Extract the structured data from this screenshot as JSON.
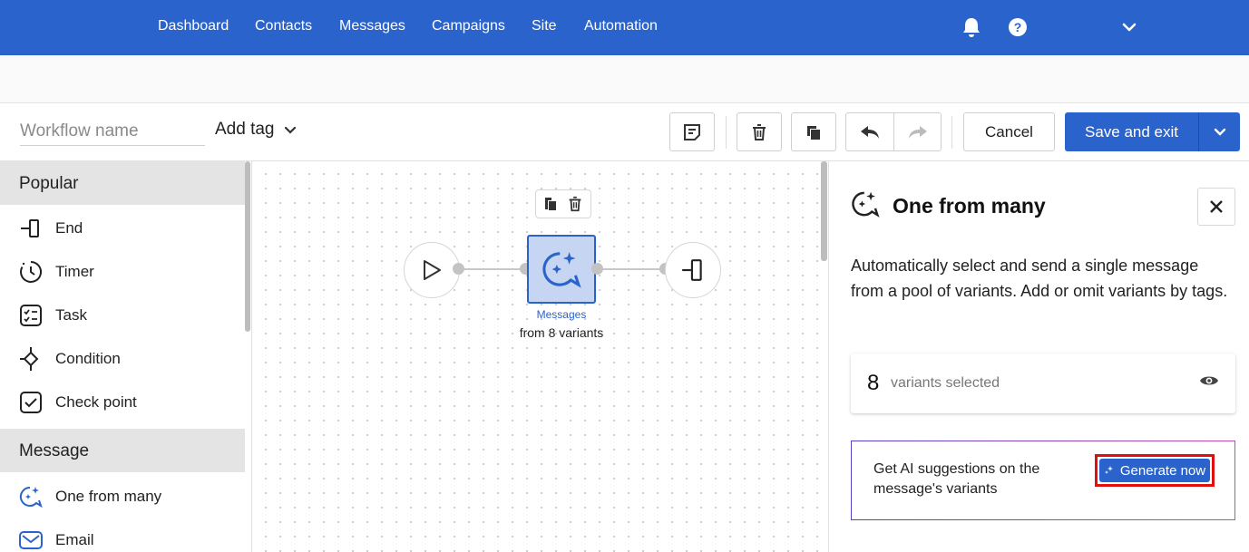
{
  "nav": {
    "items": [
      "Dashboard",
      "Contacts",
      "Messages",
      "Campaigns",
      "Site",
      "Automation"
    ],
    "icons": [
      "bell-icon",
      "help-icon",
      "chevron-down-icon"
    ]
  },
  "toolbar": {
    "workflow_name_placeholder": "Workflow name",
    "add_tag_label": "Add tag",
    "cancel_label": "Cancel",
    "save_label": "Save and exit"
  },
  "sidebar": {
    "sections": [
      {
        "title": "Popular",
        "items": [
          {
            "label": "End",
            "icon": "end-icon"
          },
          {
            "label": "Timer",
            "icon": "timer-icon"
          },
          {
            "label": "Task",
            "icon": "task-icon"
          },
          {
            "label": "Condition",
            "icon": "condition-icon"
          },
          {
            "label": "Check point",
            "icon": "check-point-icon"
          }
        ]
      },
      {
        "title": "Message",
        "items": [
          {
            "label": "One from many",
            "icon": "sparkle-chat-icon"
          },
          {
            "label": "Email",
            "icon": "email-icon"
          }
        ]
      }
    ]
  },
  "canvas": {
    "node_caption_1": "Messages",
    "node_caption_2": "from 8 variants"
  },
  "panel": {
    "title": "One from many",
    "description": "Automatically select and send a single message from a pool of variants. Add or omit variants by tags.",
    "variant_count": "8",
    "variant_label": "variants selected",
    "ai_text": "Get AI suggestions on the message's variants",
    "generate_label": "Generate now"
  },
  "colors": {
    "brand_blue": "#2b63cd",
    "highlight_red": "#e01010",
    "node_fill": "#c6d5f2"
  }
}
